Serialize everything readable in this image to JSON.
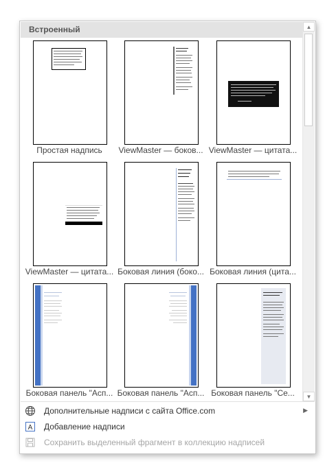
{
  "gallery": {
    "section_title": "Встроенный",
    "items": [
      {
        "caption": "Простая надпись",
        "style": "simple"
      },
      {
        "caption": "ViewMaster — боков...",
        "style": "vm-side"
      },
      {
        "caption": "ViewMaster — цитата...",
        "style": "vm-quote-dark"
      },
      {
        "caption": "ViewMaster — цитата...",
        "style": "vm-quote-bar"
      },
      {
        "caption": "Боковая линия (боко...",
        "style": "line-side"
      },
      {
        "caption": "Боковая линия (цита...",
        "style": "line-quote"
      },
      {
        "caption": "Боковая панель \"Асп...",
        "style": "aspect-left"
      },
      {
        "caption": "Боковая панель \"Асп...",
        "style": "aspect-right"
      },
      {
        "caption": "Боковая панель \"Се...",
        "style": "grid-panel"
      }
    ]
  },
  "menu": {
    "more_online": "Дополнительные надписи с сайта Office.com",
    "draw_textbox": "Добавление надписи",
    "save_selection": "Сохранить выделенный фрагмент в коллекцию надписей"
  },
  "colors": {
    "accent_blue": "#4472c4",
    "header_bg": "#e3e3e3"
  }
}
